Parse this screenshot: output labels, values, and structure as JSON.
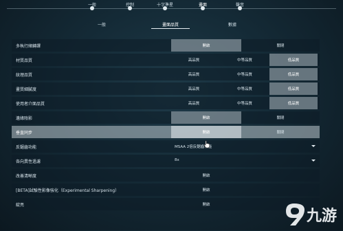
{
  "top_tabs": [
    {
      "label": "一般",
      "active": false
    },
    {
      "label": "控制",
      "active": false
    },
    {
      "label": "十字準星",
      "active": false
    },
    {
      "label": "畫面",
      "active": true
    },
    {
      "label": "聲音",
      "active": false
    }
  ],
  "sub_tabs": [
    {
      "label": "一般",
      "active": false
    },
    {
      "label": "畫面品質",
      "active": true
    },
    {
      "label": "數據",
      "active": false
    }
  ],
  "settings": [
    {
      "label": "多執行緒轉譯",
      "options": [
        "開啟",
        "關閉"
      ],
      "selected": 0
    },
    {
      "label": "材質品質",
      "options": [
        "高品質",
        "中等品質",
        "低品質"
      ],
      "selected": 2
    },
    {
      "label": "紋理品質",
      "options": [
        "高品質",
        "中等品質",
        "低品質"
      ],
      "selected": 2
    },
    {
      "label": "畫質細膩度",
      "options": [
        "高品質",
        "中等品質",
        "低品質"
      ],
      "selected": 2
    },
    {
      "label": "使用者介面品質",
      "options": [
        "高品質",
        "中等品質",
        "低品質"
      ],
      "selected": 2
    },
    {
      "label": "邊緣陰影",
      "options": [
        "開啟",
        "關閉"
      ],
      "selected": 0
    },
    {
      "label": "垂直同步",
      "options": [
        "開啟",
        "關閉"
      ],
      "selected": 0
    },
    {
      "label": "反鋸齒功能",
      "dropdown": "MSAA 2倍反鋸齒功能"
    },
    {
      "label": "各向異性過濾",
      "dropdown": "8x"
    },
    {
      "label": "改善清晰度",
      "options": [
        "開啟"
      ],
      "selected": -1
    },
    {
      "label": "[BETA]試驗性影像強化（Experimental Sharpening）",
      "options": [
        "開啟"
      ],
      "selected": -1
    },
    {
      "label": "綻亮",
      "options": [
        "開啟"
      ],
      "selected": -1
    }
  ],
  "highlighted_row": 6,
  "watermark": {
    "text": "九游",
    "icon": "nine-game-logo-icon"
  },
  "colors": {
    "accent": "#e6eef2",
    "background": "#142a36"
  }
}
